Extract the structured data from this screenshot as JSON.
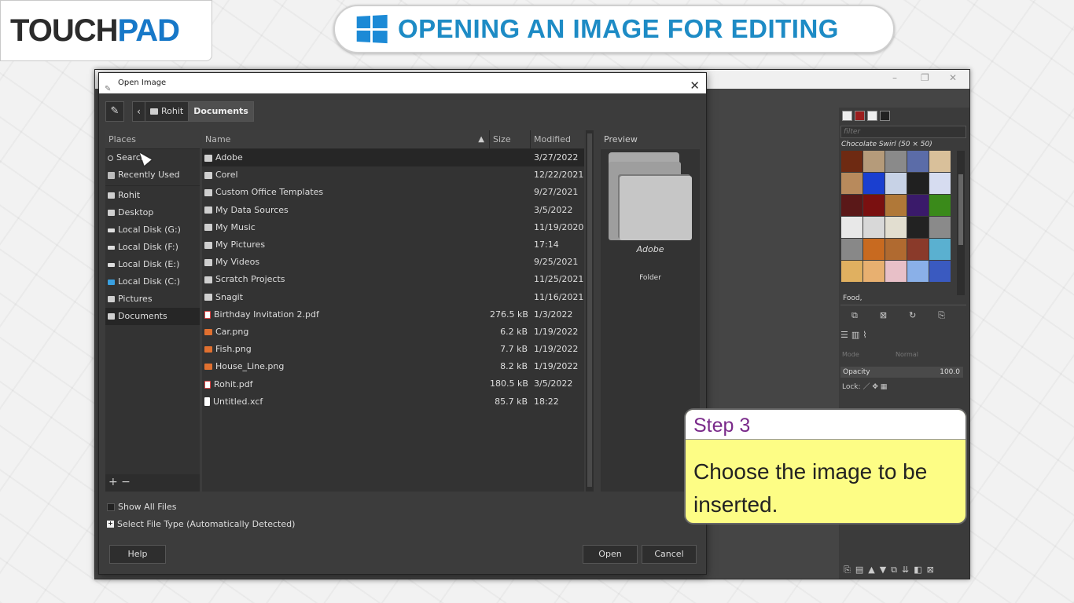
{
  "brand": {
    "logo_part1": "TOUCH",
    "logo_part2": "PAD"
  },
  "lesson_title": "OPENING AN IMAGE FOR EDITING",
  "colors": {
    "title_blue": "#1d8bc5",
    "step_purple": "#7a2a8a",
    "step_yellow": "#fdfd85"
  },
  "gimp": {
    "dock": {
      "filter_placeholder": "filter",
      "pattern_name": "Chocolate Swirl (50 × 50)",
      "tag": "Food,",
      "mode_label": "Mode",
      "mode_value": "Normal",
      "opacity_label": "Opacity",
      "opacity_value": "100.0",
      "lock_label": "Lock:"
    },
    "pattern_colors": [
      "#6e2a12",
      "#b59b7a",
      "#8a8a8a",
      "#5b6ca8",
      "#d9c09a",
      "#b88a5c",
      "#1a3fd0",
      "#c7d2e6",
      "#202020",
      "#d6dcf0",
      "#5a1818",
      "#7a1010",
      "#b07838",
      "#3a1a6a",
      "#3a8a1a",
      "#e8e8e8",
      "#d8d8d8",
      "#e2ded0",
      "#222",
      "#8a8a8a",
      "#888888",
      "#c86a20",
      "#b06a30",
      "#8a3a2a",
      "#5ab0d0",
      "#e0b060",
      "#e8b070",
      "#e8c0c8",
      "#8ab0e8",
      "#3a5ac0"
    ]
  },
  "dialog": {
    "title": "Open Image",
    "breadcrumbs": [
      "Rohit",
      "Documents"
    ],
    "places_header": "Places",
    "places": [
      {
        "label": "Search",
        "icon": "search"
      },
      {
        "label": "Recently Used",
        "icon": "recent"
      },
      {
        "label": "Rohit",
        "icon": "folder"
      },
      {
        "label": "Desktop",
        "icon": "folder"
      },
      {
        "label": "Local Disk (G:)",
        "icon": "drive"
      },
      {
        "label": "Local Disk (F:)",
        "icon": "drive"
      },
      {
        "label": "Local Disk (E:)",
        "icon": "drive"
      },
      {
        "label": "Local Disk (C:)",
        "icon": "drive-c"
      },
      {
        "label": "Pictures",
        "icon": "folder"
      },
      {
        "label": "Documents",
        "icon": "folder"
      }
    ],
    "places_footer": "+ −",
    "columns": {
      "name": "Name",
      "size": "Size",
      "modified": "Modified"
    },
    "files": [
      {
        "name": "Adobe",
        "size": "",
        "modified": "3/27/2022",
        "type": "folder"
      },
      {
        "name": "Corel",
        "size": "",
        "modified": "12/22/2021",
        "type": "folder"
      },
      {
        "name": "Custom Office Templates",
        "size": "",
        "modified": "9/27/2021",
        "type": "folder"
      },
      {
        "name": "My Data Sources",
        "size": "",
        "modified": "3/5/2022",
        "type": "folder"
      },
      {
        "name": "My Music",
        "size": "",
        "modified": "11/19/2020",
        "type": "folder"
      },
      {
        "name": "My Pictures",
        "size": "",
        "modified": "17:14",
        "type": "folder"
      },
      {
        "name": "My Videos",
        "size": "",
        "modified": "9/25/2021",
        "type": "folder"
      },
      {
        "name": "Scratch Projects",
        "size": "",
        "modified": "11/25/2021",
        "type": "folder"
      },
      {
        "name": "Snagit",
        "size": "",
        "modified": "11/16/2021",
        "type": "folder"
      },
      {
        "name": "Birthday Invitation 2.pdf",
        "size": "276.5 kB",
        "modified": "1/3/2022",
        "type": "pdf"
      },
      {
        "name": "Car.png",
        "size": "6.2 kB",
        "modified": "1/19/2022",
        "type": "png"
      },
      {
        "name": "Fish.png",
        "size": "7.7 kB",
        "modified": "1/19/2022",
        "type": "png"
      },
      {
        "name": "House_Line.png",
        "size": "8.2 kB",
        "modified": "1/19/2022",
        "type": "png"
      },
      {
        "name": "Rohit.pdf",
        "size": "180.5 kB",
        "modified": "3/5/2022",
        "type": "pdf"
      },
      {
        "name": "Untitled.xcf",
        "size": "85.7 kB",
        "modified": "18:22",
        "type": "xcf"
      }
    ],
    "preview": {
      "header": "Preview",
      "name": "Adobe",
      "type": "Folder"
    },
    "show_all_files": "Show All Files",
    "select_file_type": "Select File Type (Automatically Detected)",
    "buttons": {
      "help": "Help",
      "open": "Open",
      "cancel": "Cancel"
    }
  },
  "step": {
    "title": "Step 3",
    "text": "Choose the image to be inserted."
  }
}
